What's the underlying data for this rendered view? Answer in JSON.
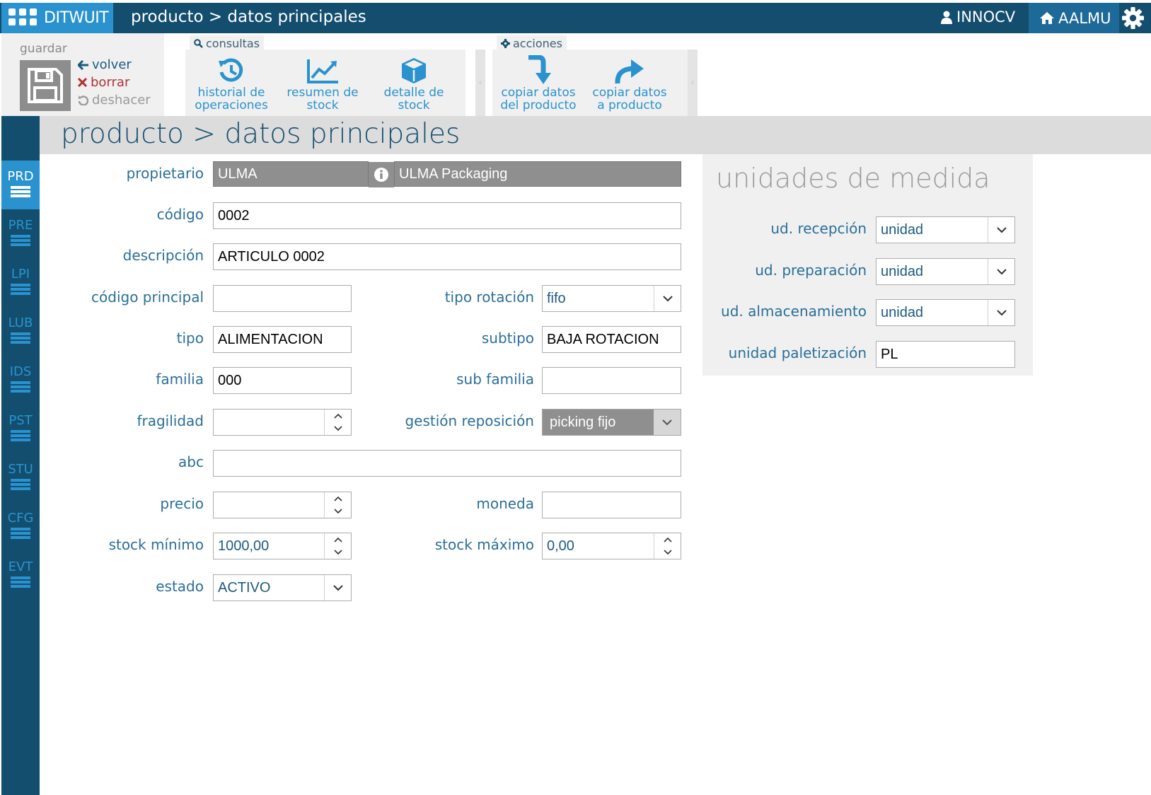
{
  "app": {
    "name": "DITWUIT",
    "breadcrumb": "producto > datos principales",
    "user": "INNOCV",
    "warehouse": "AALMU"
  },
  "ribbon": {
    "guardar_label": "guardar",
    "volver_label": "volver",
    "borrar_label": "borrar",
    "deshacer_label": "deshacer",
    "consultas_label": "consultas",
    "acciones_label": "acciones",
    "consultas": [
      {
        "line1": "historial de",
        "line2": "operaciones",
        "icon": "history-icon"
      },
      {
        "line1": "resumen de",
        "line2": "stock",
        "icon": "chart-line-icon"
      },
      {
        "line1": "detalle de",
        "line2": "stock",
        "icon": "cube-icon"
      }
    ],
    "acciones": [
      {
        "line1": "copiar datos",
        "line2": "del producto",
        "icon": "arrow-down-turn-icon"
      },
      {
        "line1": "copiar datos",
        "line2": "a producto",
        "icon": "share-arrow-icon"
      }
    ]
  },
  "sidebar": {
    "items": [
      {
        "code": "PRD",
        "active": true
      },
      {
        "code": "PRE",
        "active": false
      },
      {
        "code": "LPI",
        "active": false
      },
      {
        "code": "LUB",
        "active": false
      },
      {
        "code": "IDS",
        "active": false
      },
      {
        "code": "PST",
        "active": false
      },
      {
        "code": "STU",
        "active": false
      },
      {
        "code": "CFG",
        "active": false
      },
      {
        "code": "EVT",
        "active": false
      }
    ]
  },
  "page": {
    "title": "producto > datos principales"
  },
  "form": {
    "propietario": {
      "label": "propietario",
      "code": "ULMA",
      "name": "ULMA Packaging"
    },
    "codigo": {
      "label": "código",
      "value": "0002"
    },
    "descripcion": {
      "label": "descripción",
      "value": "ARTICULO 0002"
    },
    "codigo_principal": {
      "label": "código principal",
      "value": ""
    },
    "tipo_rotacion": {
      "label": "tipo rotación",
      "value": "fifo"
    },
    "tipo": {
      "label": "tipo",
      "value": "ALIMENTACION"
    },
    "subtipo": {
      "label": "subtipo",
      "value": "BAJA ROTACION"
    },
    "familia": {
      "label": "familia",
      "value": "000"
    },
    "sub_familia": {
      "label": "sub familia",
      "value": ""
    },
    "fragilidad": {
      "label": "fragilidad",
      "value": ""
    },
    "gestion_reposicion": {
      "label": "gestión reposición",
      "value": "picking fijo"
    },
    "abc": {
      "label": "abc",
      "value": ""
    },
    "precio": {
      "label": "precio",
      "value": ""
    },
    "moneda": {
      "label": "moneda",
      "value": ""
    },
    "stock_minimo": {
      "label": "stock mínimo",
      "value": "1000,00"
    },
    "stock_maximo": {
      "label": "stock máximo",
      "value": "0,00"
    },
    "estado": {
      "label": "estado",
      "value": "ACTIVO"
    }
  },
  "units": {
    "title": "unidades de medida",
    "recepcion": {
      "label": "ud. recepción",
      "value": "unidad"
    },
    "preparacion": {
      "label": "ud. preparación",
      "value": "unidad"
    },
    "almacenamiento": {
      "label": "ud. almacenamiento",
      "value": "unidad"
    },
    "paletizacion": {
      "label": "unidad paletización",
      "value": "PL"
    }
  },
  "colors": {
    "topbar": "#134e6f",
    "accent": "#2a93cf",
    "label": "#2a6f98",
    "danger": "#b43232"
  }
}
